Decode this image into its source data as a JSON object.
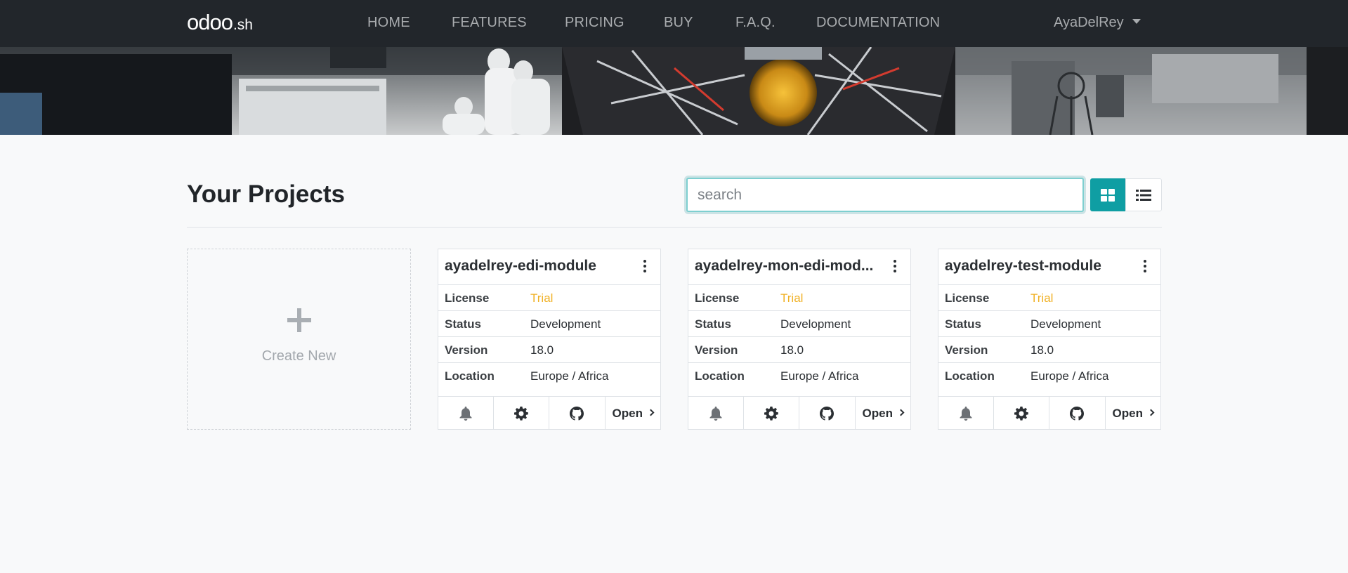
{
  "navbar": {
    "logo_main": "odoo",
    "logo_sub": ".sh",
    "items": [
      {
        "label": "HOME"
      },
      {
        "label": "FEATURES"
      },
      {
        "label": "PRICING"
      },
      {
        "label": "BUY"
      },
      {
        "label": "F.A.Q."
      },
      {
        "label": "DOCUMENTATION"
      }
    ],
    "user": "AyaDelRey"
  },
  "main": {
    "title": "Your Projects",
    "search_placeholder": "search",
    "create_new": "Create New"
  },
  "colors": {
    "navbar": "#22262b",
    "accent": "#0f9ea3",
    "trial": "#f0b125"
  },
  "projects": [
    {
      "name": "ayadelrey-edi-module",
      "rows": [
        {
          "label": "License",
          "value": "Trial"
        },
        {
          "label": "Status",
          "value": "Development"
        },
        {
          "label": "Version",
          "value": "18.0"
        },
        {
          "label": "Location",
          "value": "Europe / Africa"
        }
      ],
      "open": "Open"
    },
    {
      "name": "ayadelrey-mon-edi-mod...",
      "rows": [
        {
          "label": "License",
          "value": "Trial"
        },
        {
          "label": "Status",
          "value": "Development"
        },
        {
          "label": "Version",
          "value": "18.0"
        },
        {
          "label": "Location",
          "value": "Europe / Africa"
        }
      ],
      "open": "Open"
    },
    {
      "name": "ayadelrey-test-module",
      "rows": [
        {
          "label": "License",
          "value": "Trial"
        },
        {
          "label": "Status",
          "value": "Development"
        },
        {
          "label": "Version",
          "value": "18.0"
        },
        {
          "label": "Location",
          "value": "Europe / Africa"
        }
      ],
      "open": "Open"
    }
  ],
  "icons": {
    "footer": [
      "bell-icon",
      "gear-icon",
      "github-icon",
      "chevron-right-icon"
    ],
    "view": [
      "grid-view-icon",
      "list-view-icon"
    ]
  }
}
